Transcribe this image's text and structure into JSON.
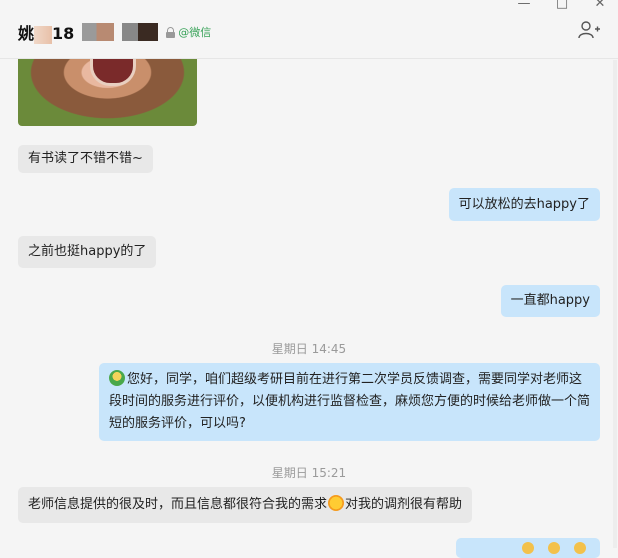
{
  "window": {
    "minimize": "—",
    "maximize": "□",
    "close": "✕"
  },
  "header": {
    "name_first": "姚",
    "name_digits": "18",
    "badge_label": "@微信"
  },
  "icons": {
    "add_user": "add-user-icon",
    "lock": "lock-icon"
  },
  "messages": [
    {
      "from": "them",
      "text": "有书读了不错不错~"
    },
    {
      "from": "me",
      "text": "可以放松的去happy了"
    },
    {
      "from": "them",
      "text": "之前也挺happy的了"
    },
    {
      "from": "me",
      "text": "一直都happy"
    }
  ],
  "timestamps": {
    "t1": "星期日 14:45",
    "t2": "星期日 15:21"
  },
  "survey": {
    "text": "您好，同学，咱们超级考研目前在进行第二次学员反馈调查，需要同学对老师这段时间的服务进行评价，以便机构进行监督检查，麻烦您方便的时候给老师做一个简短的服务评价，可以吗?"
  },
  "reply": {
    "part1": "老师信息提供的很及时，而且信息都很符合我的需求",
    "part2": "对我的调剂很有帮助"
  },
  "colors": {
    "incoming_bubble": "#e8e8e8",
    "outgoing_bubble": "#c8e5fb",
    "badge_green": "#3aa35a"
  }
}
